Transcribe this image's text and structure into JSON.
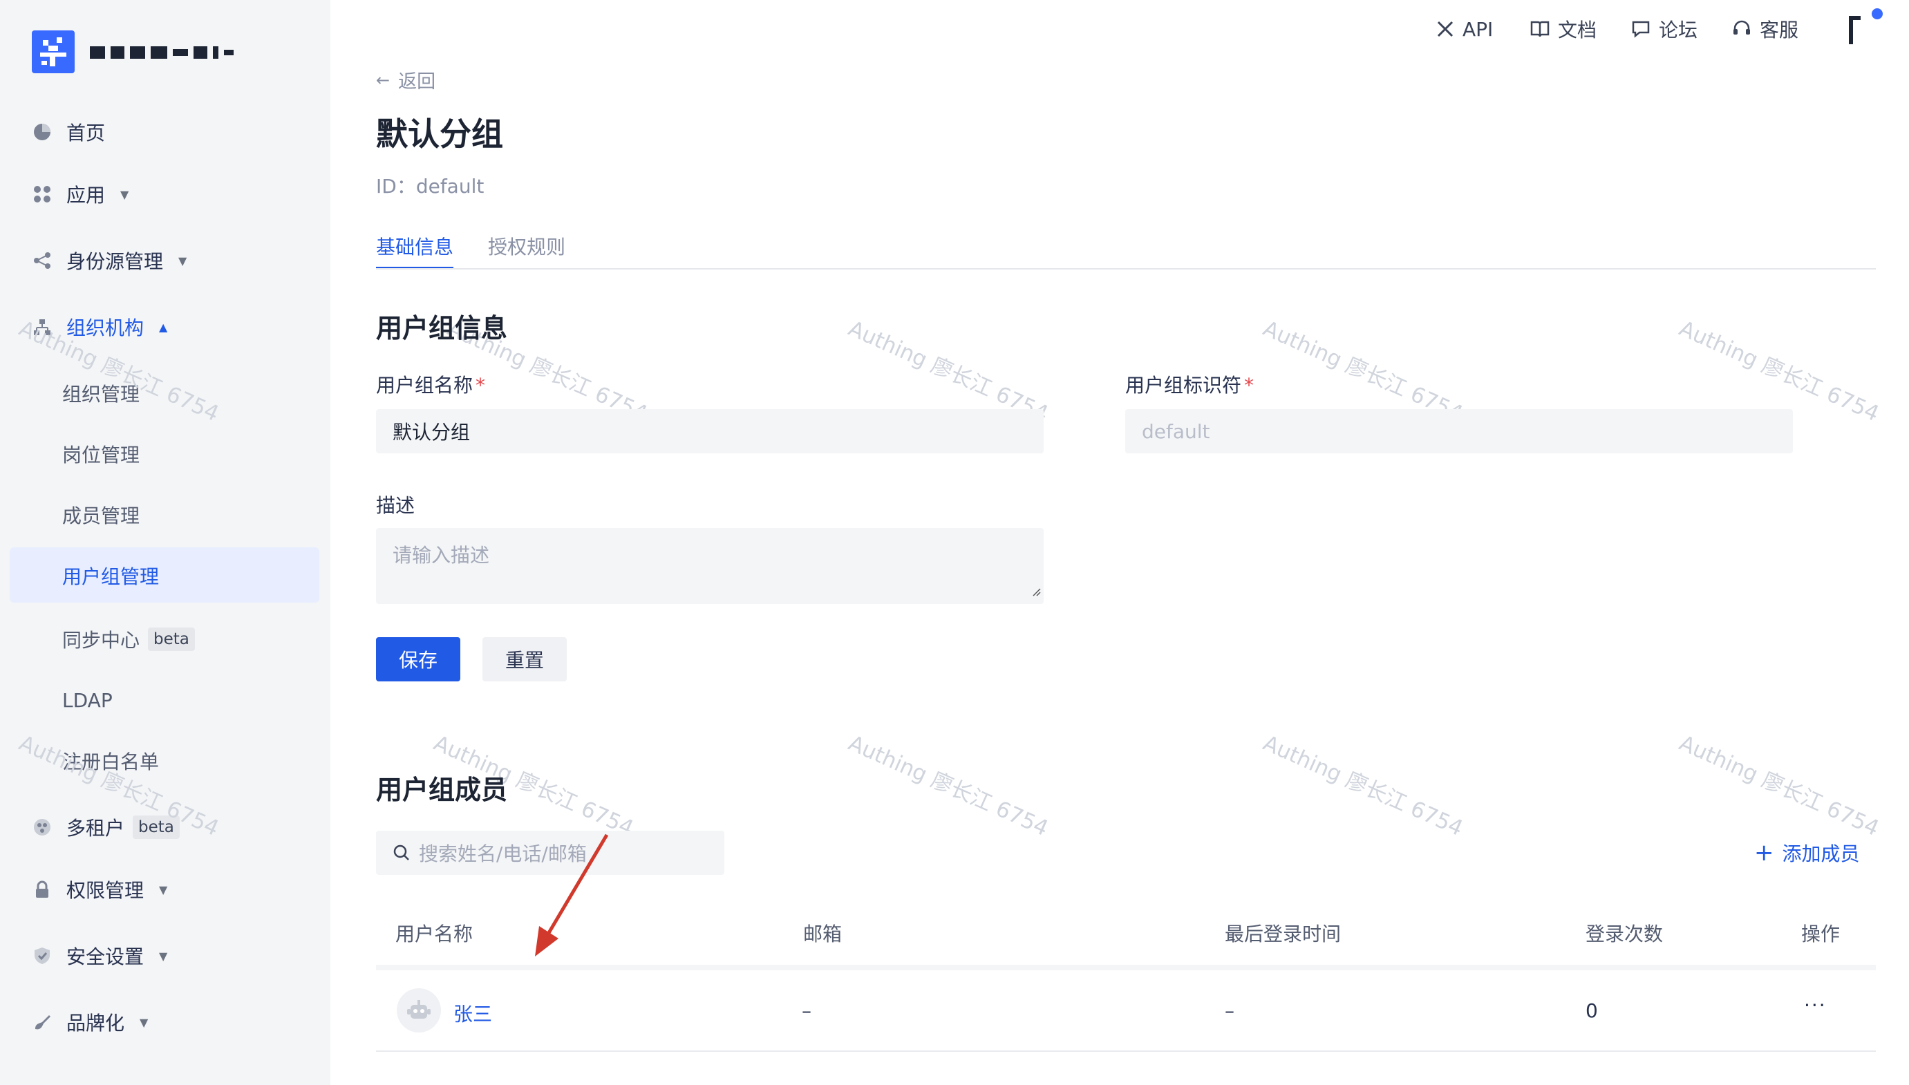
{
  "sidebar": {
    "logo_text": "",
    "items": [
      {
        "label": "首页"
      },
      {
        "label": "应用"
      },
      {
        "label": "身份源管理"
      },
      {
        "label": "组织机构"
      },
      {
        "label": "多租户",
        "badge": "beta"
      },
      {
        "label": "权限管理"
      },
      {
        "label": "安全设置"
      },
      {
        "label": "品牌化"
      }
    ],
    "sub_items": [
      {
        "label": "组织管理"
      },
      {
        "label": "岗位管理"
      },
      {
        "label": "成员管理"
      },
      {
        "label": "用户组管理"
      },
      {
        "label": "同步中心",
        "badge": "beta"
      },
      {
        "label": "LDAP"
      },
      {
        "label": "注册白名单"
      }
    ]
  },
  "topbar": {
    "links": [
      {
        "label": "API",
        "icon": "tools-icon"
      },
      {
        "label": "文档",
        "icon": "book-icon"
      },
      {
        "label": "论坛",
        "icon": "chat-icon"
      },
      {
        "label": "客服",
        "icon": "headset-icon"
      }
    ]
  },
  "page": {
    "back_label": "返回",
    "title": "默认分组",
    "id_line": "ID：default",
    "tabs": [
      {
        "label": "基础信息",
        "active": true
      },
      {
        "label": "授权规则",
        "active": false
      }
    ]
  },
  "group_info": {
    "section_title": "用户组信息",
    "name_label": "用户组名称",
    "name_value": "默认分组",
    "code_label": "用户组标识符",
    "code_value": "default",
    "required_mark": "*",
    "desc_label": "描述",
    "desc_placeholder": "请输入描述",
    "save_label": "保存",
    "reset_label": "重置"
  },
  "members": {
    "section_title": "用户组成员",
    "search_placeholder": "搜索姓名/电话/邮箱",
    "add_label": "添加成员",
    "columns": [
      "用户名称",
      "邮箱",
      "最后登录时间",
      "登录次数",
      "操作"
    ],
    "rows": [
      {
        "name": "张三",
        "email": "–",
        "last_login": "–",
        "login_count": "0",
        "actions": "···"
      }
    ]
  },
  "watermark": "Authing 廖长江 6754",
  "colors": {
    "primary": "#215ae5",
    "logo": "#396aff",
    "annotation_arrow": "#d0392b"
  }
}
